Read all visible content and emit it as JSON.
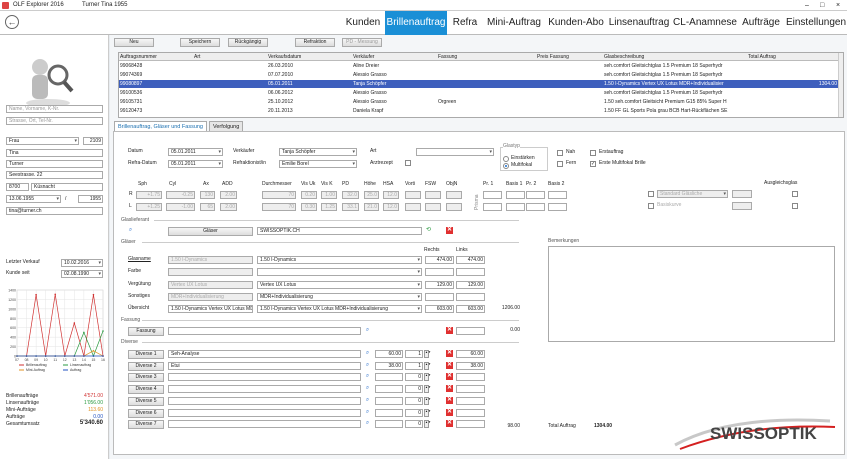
{
  "titlebar": {
    "app": "OLF Explorer 2016",
    "user": "Turner  Tina  1955",
    "min": "–",
    "max": "□",
    "close": "×"
  },
  "nav": {
    "tabs": [
      "Kunden",
      "Brillenauftrag",
      "Refra",
      "Mini-Auftrag",
      "Kunden-Abo",
      "Linsenauftrag",
      "CL-Anamnese",
      "Aufträge",
      "Einstellungen"
    ],
    "active": 1
  },
  "left": {
    "search_name": "Name, Vorname, K-Nr.",
    "search_addr": "Strasse, Ort, Tel-Nr.",
    "anrede": "Frau",
    "nr": "2109",
    "vorname": "Tina",
    "name": "Turner",
    "strasse": "Seestrasse. 22",
    "plz": "8700",
    "ort": "Küsnacht",
    "geb": "13.06.1955",
    "slash": "/",
    "jahr": "1955",
    "email": "tina@turner.ch",
    "letzter_verkauf_label": "Letzter Verkauf",
    "letzter_verkauf": "10.02.2016",
    "kunde_seit_label": "Kunde seit",
    "kunde_seit": "02.08.1990",
    "chart_y": [
      "1400",
      "1200",
      "1000",
      "800",
      "600",
      "400",
      "200",
      "0"
    ],
    "chart_x": [
      "07",
      "08",
      "09",
      "10",
      "11",
      "12",
      "13",
      "14",
      "15",
      "16"
    ],
    "legend": {
      "brille": "Brillenauftrag",
      "linsen": "Linsenauftrag",
      "mini": "Mini-Auftrag",
      "auftrag": "Auftrag"
    },
    "totals": [
      {
        "label": "Brillenaufträge",
        "value": "4'571.00"
      },
      {
        "label": "Linsenaufträge",
        "value": "1'056.00"
      },
      {
        "label": "Mini-Aufträge",
        "value": "113.60"
      },
      {
        "label": "Aufträge",
        "value": "0.00"
      },
      {
        "label": "Gesamtumsatz",
        "value": "5'340.60"
      }
    ]
  },
  "chart_data": {
    "type": "line",
    "x": [
      "07",
      "08",
      "09",
      "10",
      "11",
      "12",
      "13",
      "14",
      "15",
      "16"
    ],
    "ylim": [
      0,
      1400
    ],
    "series": [
      {
        "name": "Brillenauftrag",
        "color": "#d03030",
        "values": [
          0,
          0,
          1300,
          0,
          1310,
          0,
          700,
          0,
          1300,
          0
        ]
      },
      {
        "name": "Linsenauftrag",
        "color": "#2a9a40",
        "values": [
          0,
          0,
          0,
          0,
          0,
          0,
          0,
          500,
          0,
          530
        ]
      },
      {
        "name": "Mini-Auftrag",
        "color": "#e09020",
        "values": [
          0,
          0,
          0,
          0,
          0,
          0,
          0,
          0,
          110,
          0
        ]
      },
      {
        "name": "Auftrag",
        "color": "#2050c0",
        "values": [
          0,
          0,
          0,
          0,
          0,
          0,
          0,
          0,
          0,
          0
        ]
      }
    ]
  },
  "toolbar": {
    "neu": "Neu",
    "speichern": "Speichern",
    "rueck": "Rückgängig",
    "refraktion": "Refraktion",
    "pd": "PD - Messung"
  },
  "grid": {
    "headers": [
      "Auftragsnummer",
      "Art",
      "Verkaufsdatum",
      "Verkäufer",
      "Fassung",
      "Preis Fassung",
      "Glasbeschreibung",
      "Total Auftrag"
    ],
    "rows": [
      [
        "99068428",
        "",
        "26.03.2010",
        "Aline Dreier",
        "",
        "",
        "seh.comfort Gleitsichtglas 1.5 Premium 18    Superhydr",
        ""
      ],
      [
        "99074369",
        "",
        "07.07.2010",
        "Alessio Grasso",
        "",
        "",
        "seh.comfort Gleitsichtglas 1.5 Premium 18    Superhydr",
        ""
      ],
      [
        "99080897",
        "",
        "05.01.2011",
        "Tanja Schöpfer",
        "",
        "",
        "1.50 I-Dynamics    Vertex UX Lotus    MDR+Individualisier",
        "1304.00"
      ],
      [
        "99100536",
        "",
        "06.06.2012",
        "Alessio Grasso",
        "",
        "",
        "seh.comfort Gleitsichtglas 1.5 Premium 18    Superhydr",
        ""
      ],
      [
        "99105731",
        "",
        "25.10.2012",
        "Alessio Grasso",
        "Orgreen",
        "",
        "1.50 seh.comfort Gleitsicht Premium  G15 85%  Super H",
        ""
      ],
      [
        "99120473",
        "",
        "20.11.2013",
        "Daniela Krapf",
        "",
        "",
        "1.50 FF GL Sports Pola grau BCB    Hart-Rückflächen SE",
        ""
      ]
    ],
    "selected": 2
  },
  "subtabs": [
    "Brillenauftrag, Gläser und Fassung",
    "Verfolgung"
  ],
  "form": {
    "datum_l": "Datum",
    "datum": "05.01.2011",
    "refra_l": "Refra-Datum",
    "refra": "05.01.2011",
    "verk_l": "Verkäufer",
    "verk": "Tanja Schöpfer",
    "refr_l": "Refraktionist/in",
    "refr": "Emilie Borel",
    "art_l": "Art",
    "arzt_l": "Arztrezept",
    "glastyp_l": "Glastyp",
    "einst": "Einstärken",
    "multi": "Multifokal",
    "nah": "Nah",
    "fern": "Fern",
    "erst": "Erstauftrag",
    "erste_multi": "Erste Multifokal Brille",
    "refr_headers": [
      "Sph",
      "Cyl",
      "Ax",
      "ADD",
      "Durchmesser",
      "Vis Uk",
      "Vis K",
      "PD",
      "Höhe",
      "HSA",
      "Vorti",
      "FSW",
      "ObjN",
      "Pr. 1",
      "Basis 1",
      "Pr. 2",
      "Basis 2"
    ],
    "R": [
      "+1.75",
      "-0.25",
      "130",
      "2.00",
      "70",
      "0.20",
      "1.00",
      "32.0",
      "25.0",
      "12.0",
      "",
      "",
      ""
    ],
    "L": [
      "+1.25",
      "-1.00",
      "65",
      "2.00",
      "70",
      "0.30",
      "1.25",
      "33.1",
      "21.0",
      "12.0",
      "",
      "",
      ""
    ],
    "rl": [
      "R",
      "L"
    ],
    "prisma": "Prisma",
    "std_glas": "Standard Gläsliche",
    "basiskurve": "Basiskurve",
    "ausgleich": "Ausgleichsglas",
    "glaslief_l": "Glaslieferant",
    "glaeser_btn": "Gläser",
    "glaeser_val": "SWISSOPTIK.CH",
    "glaeser_l": "Gläser",
    "rechts": "Rechts",
    "links": "Links",
    "glasname_l": "Glasname",
    "glasname_l1": "1.50 I-Dynamics",
    "glasname": "1.50 I-Dynamics",
    "glasname_r": "474.00",
    "glasname_li": "474.00",
    "farbe_l": "Farbe",
    "verg_l": "Vergütung",
    "verg_l1": "Vertex UX Lotus",
    "verg": "Vertex UX Lotus",
    "verg_r": "129.00",
    "verg_li": "129.00",
    "sonst_l": "Sonstiges",
    "sonst_l1": "MDR+Individualisierung",
    "sonst": "MDR+Individualisierung",
    "uebers_l": "Übersicht",
    "uebers_l1": "1.50 I-Dynamics   Vertex UX Lotus   MDR+Individua",
    "uebers": "1.50 I-Dynamics   Vertex UX Lotus   MDR+Individualisierung",
    "uebers_r": "603.00",
    "uebers_li": "603.00",
    "uebers_t": "1206.00",
    "fassung_sec": "Fassung",
    "fassung_btn": "Fassung",
    "fassung_t": "0.00",
    "diverse_sec": "Diverse",
    "diverse": [
      {
        "btn": "Diverse 1",
        "val": "Seh-Analyse",
        "price": "60.00",
        "qty": "1",
        "total": "60.00"
      },
      {
        "btn": "Diverse 2",
        "val": "Etui",
        "price": "38.00",
        "qty": "1",
        "total": "38.00"
      },
      {
        "btn": "Diverse 3",
        "val": "",
        "price": "",
        "qty": "0",
        "total": ""
      },
      {
        "btn": "Diverse 4",
        "val": "",
        "price": "",
        "qty": "0",
        "total": ""
      },
      {
        "btn": "Diverse 5",
        "val": "",
        "price": "",
        "qty": "0",
        "total": ""
      },
      {
        "btn": "Diverse 6",
        "val": "",
        "price": "",
        "qty": "0",
        "total": ""
      },
      {
        "btn": "Diverse 7",
        "val": "",
        "price": "",
        "qty": "0",
        "total": ""
      }
    ],
    "diverse_t": "98.00",
    "total_l": "Total Auftrag",
    "total": "1304.00",
    "bemerk_l": "Bemerkungen",
    "brand": "SWISSOPTIK"
  }
}
